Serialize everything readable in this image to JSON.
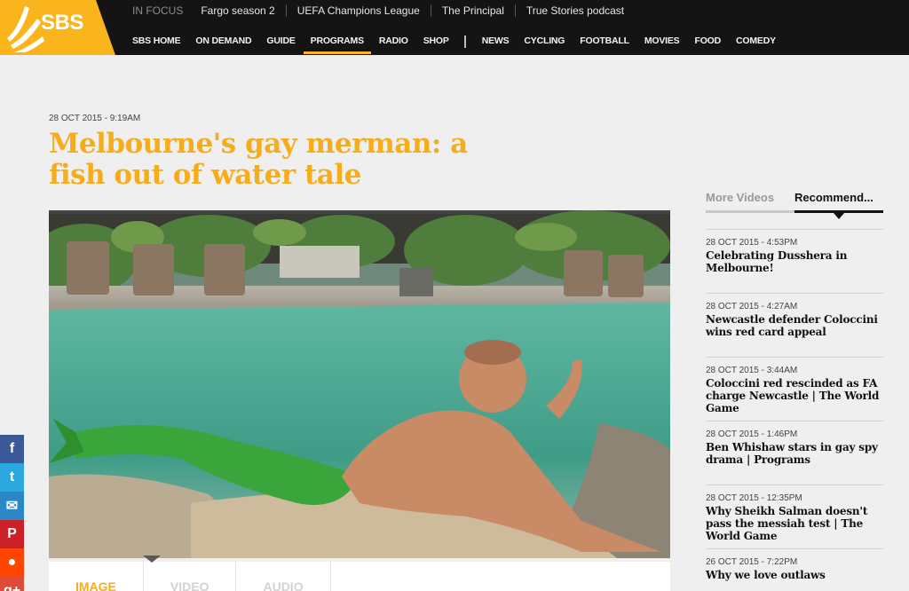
{
  "brand": {
    "logo_text": "SBS",
    "accent": "#f9b51b"
  },
  "in_focus": {
    "label": "IN FOCUS",
    "links": [
      "Fargo season 2",
      "UEFA Champions League",
      "The Principal",
      "True Stories podcast"
    ]
  },
  "nav": {
    "primary": [
      "SBS HOME",
      "ON DEMAND",
      "GUIDE",
      "PROGRAMS",
      "RADIO",
      "SHOP"
    ],
    "active": "PROGRAMS",
    "secondary": [
      "NEWS",
      "CYCLING",
      "FOOTBALL",
      "MOVIES",
      "FOOD",
      "COMEDY"
    ]
  },
  "article": {
    "date": "28 OCT 2015 - 9:19AM",
    "title": "Melbourne's gay merman: a fish out of water tale",
    "media_tabs": [
      "IMAGE",
      "VIDEO",
      "AUDIO"
    ],
    "active_media_tab": "IMAGE"
  },
  "sidebar": {
    "tabs": [
      "More Videos",
      "Recommend..."
    ],
    "active_tab": "Recommend...",
    "items": [
      {
        "date": "28 OCT 2015 - 4:53PM",
        "title": "Celebrating Dusshera in Melbourne!"
      },
      {
        "date": "28 OCT 2015 - 4:27AM",
        "title": "Newcastle defender Coloccini wins red card appeal"
      },
      {
        "date": "28 OCT 2015 - 3:44AM",
        "title": "Coloccini red rescinded as FA charge Newcastle | The World Game"
      },
      {
        "date": "28 OCT 2015 - 1:46PM",
        "title": "Ben Whishaw stars in gay spy drama | Programs"
      },
      {
        "date": "28 OCT 2015 - 12:35PM",
        "title": "Why Sheikh Salman doesn't pass the messiah test | The World Game"
      },
      {
        "date": "26 OCT 2015 - 7:22PM",
        "title": "Why we love outlaws"
      }
    ]
  },
  "share": [
    {
      "icon": "facebook-icon",
      "glyph": "f",
      "color": "#3b5998"
    },
    {
      "icon": "twitter-icon",
      "glyph": "t",
      "color": "#2aa9e0"
    },
    {
      "icon": "email-icon",
      "glyph": "✉",
      "color": "#2a88c9"
    },
    {
      "icon": "pinterest-icon",
      "glyph": "P",
      "color": "#cb2027"
    },
    {
      "icon": "reddit-icon",
      "glyph": "●",
      "color": "#ff4500"
    },
    {
      "icon": "google-plus-icon",
      "glyph": "g+",
      "color": "#dd4b39"
    }
  ]
}
